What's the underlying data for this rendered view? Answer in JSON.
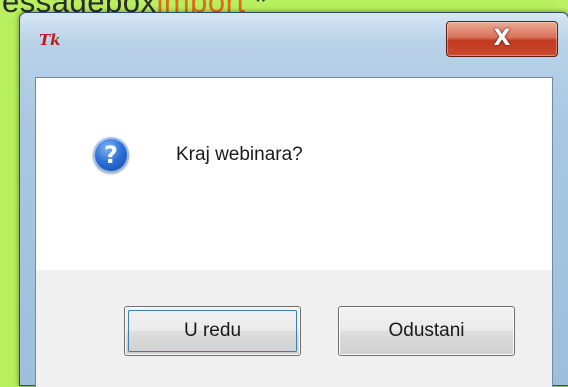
{
  "background_text": {
    "word1": "essagebox",
    "word2": "import",
    "word3": " *"
  },
  "dialog": {
    "title_icon": "Tk",
    "close_glyph": "X",
    "message": "Kraj webinara?",
    "icon": "question-icon",
    "icon_glyph": "?",
    "buttons": {
      "ok_label": "U redu",
      "cancel_label": "Odustani"
    }
  },
  "colors": {
    "background": "#b8ef5e",
    "close_button": "#c0391f",
    "question_icon": "#2a6fd6",
    "focus_ring": "#3c7fb1"
  }
}
